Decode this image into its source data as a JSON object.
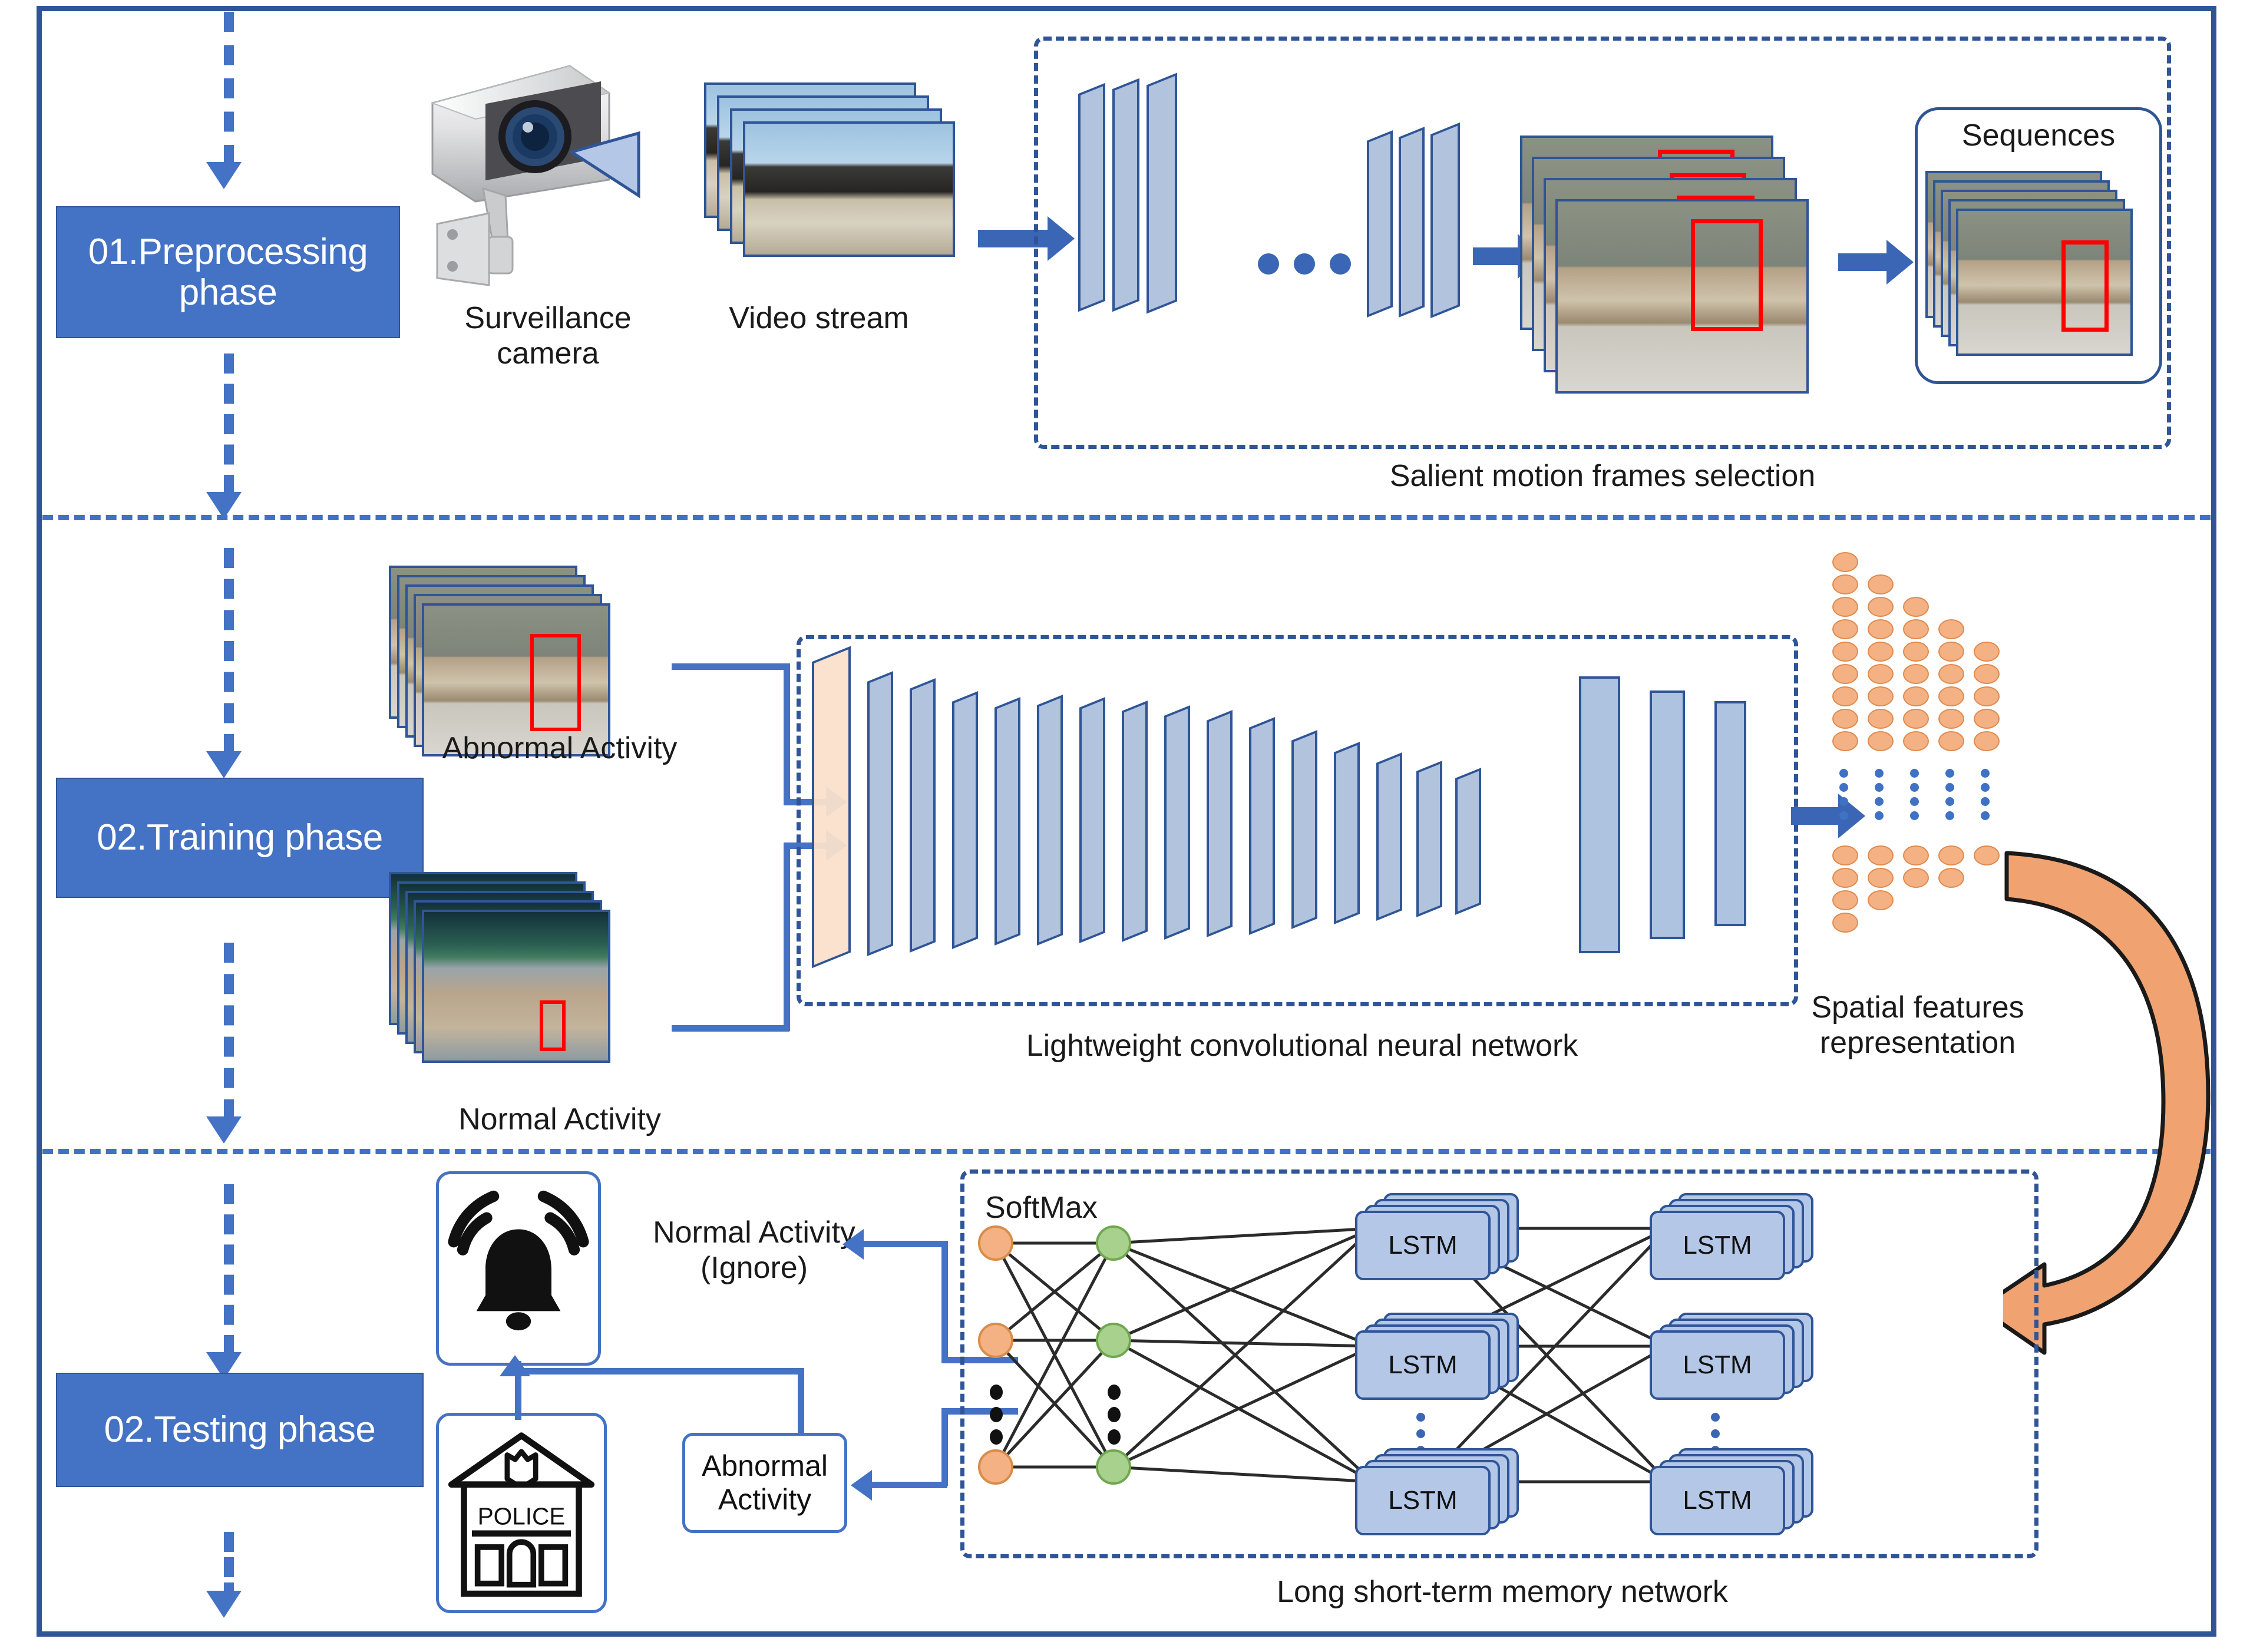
{
  "diagram": {
    "title": "Anomaly detection framework: preprocessing, training and testing phases"
  },
  "phases": [
    {
      "id": "preprocessing",
      "label": "01.Preprocessing\nphase"
    },
    {
      "id": "training",
      "label": "02.Training phase"
    },
    {
      "id": "testing",
      "label": "02.Testing phase"
    }
  ],
  "preprocessing": {
    "camera_label": "Surveillance\ncamera",
    "video_label": "Video stream",
    "module_caption": "Salient motion frames selection",
    "sequences_label": "Sequences",
    "icons": {
      "camera": "surveillance-camera-icon",
      "video": "video-stream-frames-icon",
      "detection": "detected-frames-icon",
      "sequences": "sequence-frames-icon"
    },
    "cnn_stacks": [
      {
        "plates": 3
      },
      {
        "plates": 3
      }
    ],
    "ellipsis_dots": 3
  },
  "training": {
    "abnormal_label": "Abnormal Activity",
    "normal_label": "Normal Activity",
    "cnn_caption": "Lightweight convolutional neural network",
    "features_label": "Spatial features\nrepresentation",
    "cnn_plate_count": 15,
    "cnn_bar_count": 3,
    "feature_columns": [
      9,
      8,
      7,
      6,
      5
    ]
  },
  "testing": {
    "softmax_label": "SoftMax",
    "lstm_label": "LSTM",
    "lstm_caption": "Long short-term memory network",
    "normal_decision": "Normal Activity\n(Ignore)",
    "abnormal_decision": "Abnormal\nActivity",
    "police_label": "POLICE",
    "icons": {
      "alarm": "alarm-bell-icon",
      "police": "police-station-icon"
    },
    "input_nodes": 3,
    "hidden_nodes": 3,
    "lstm_rows": 3,
    "lstm_columns": 2
  },
  "colors": {
    "phase_box_fill": "#4472c4",
    "frame_border": "#2f5597",
    "dashed_divider": "#3f72c4",
    "connector": "#4472c4",
    "plate_blue": "#a0b6d6",
    "plate_peach": "#fae0cb",
    "feature_orange": "#f4b183",
    "node_green": "#a9d18e",
    "lstm_fill": "#b4c7e7",
    "detection_box_red": "#ff0000",
    "curved_arrow": "#ef9f6e"
  }
}
